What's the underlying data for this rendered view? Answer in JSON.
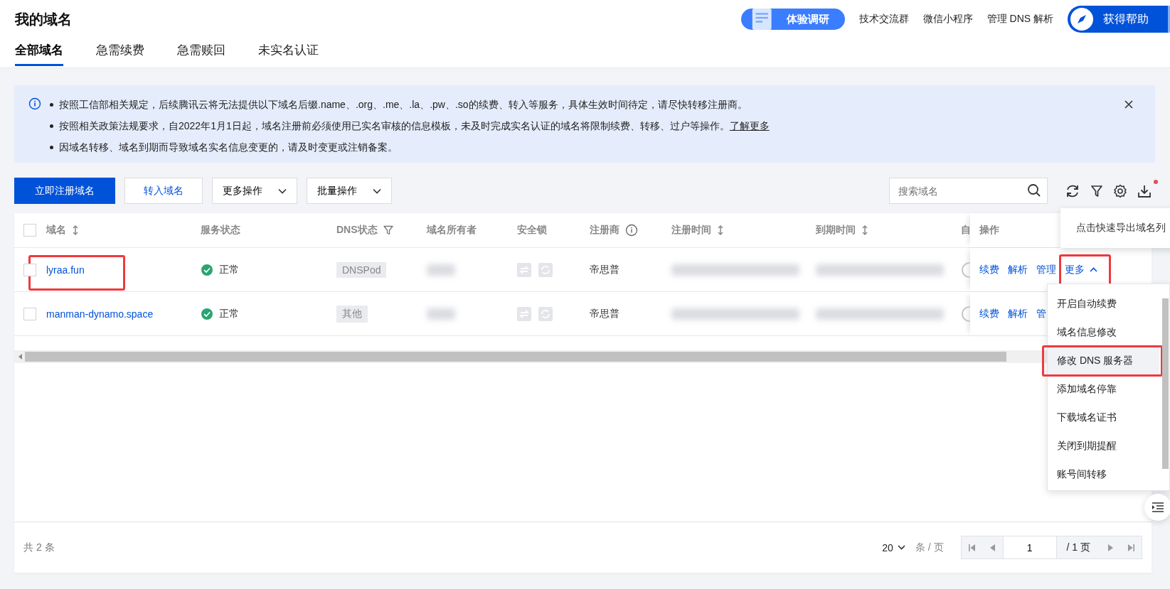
{
  "page_title": "我的域名",
  "tabs": [
    {
      "label": "全部域名",
      "selected": true
    },
    {
      "label": "急需续费",
      "selected": false
    },
    {
      "label": "急需赎回",
      "selected": false
    },
    {
      "label": "未实名认证",
      "selected": false
    }
  ],
  "header_actions": {
    "survey": "体验调研",
    "links": [
      "技术交流群",
      "微信小程序",
      "管理 DNS 解析"
    ],
    "help": "获得帮助"
  },
  "notice": {
    "lines": [
      {
        "text": "按照工信部相关规定，后续腾讯云将无法提供以下域名后缀.name、.org、.me、.la、.pw、.so的续费、转入等服务，具体生效时间待定，请尽快转移注册商。"
      },
      {
        "text": "按照相关政策法规要求，自2022年1月1日起，域名注册前必须使用已实名审核的信息模板，未及时完成实名认证的域名将限制续费、转移、过户等操作。",
        "link": "了解更多"
      },
      {
        "text": "因域名转移、域名到期而导致域名实名信息变更的，请及时变更或注销备案。"
      }
    ]
  },
  "toolbar": {
    "buttons": [
      {
        "label": "立即注册域名",
        "kind": "primary"
      },
      {
        "label": "转入域名",
        "kind": "secondary"
      },
      {
        "label": "更多操作",
        "kind": "dropdown"
      },
      {
        "label": "批量操作",
        "kind": "dropdown"
      }
    ],
    "search": {
      "placeholder": "搜索域名"
    },
    "export_badge": true
  },
  "tooltip": "点击快速导出域名列",
  "table": {
    "all_checked": false,
    "columns": [
      {
        "label": "域名",
        "kind": "sort"
      },
      {
        "label": "服务状态",
        "kind": "plain"
      },
      {
        "label": "DNS状态",
        "kind": "filter"
      },
      {
        "label": "域名所有者",
        "kind": "plain"
      },
      {
        "label": "安全锁",
        "kind": "plain"
      },
      {
        "label": "注册商",
        "kind": "info"
      },
      {
        "label": "注册时间",
        "kind": "sort"
      },
      {
        "label": "到期时间",
        "kind": "sort"
      },
      {
        "label": "自",
        "kind": "plain"
      }
    ],
    "action_column": "操作",
    "rows": [
      {
        "checked": false,
        "domain": "lyraa.fun",
        "highlighted": true,
        "status": "正常",
        "dns": "DNSPod",
        "registrar": "帝思普",
        "auto_renew": false,
        "actions": [
          {
            "label": "续费"
          },
          {
            "label": "解析"
          },
          {
            "label": "管理"
          },
          {
            "label": "更多",
            "kind": "menu",
            "expanded": true,
            "highlighted": true,
            "menu_items": [
              {
                "label": "开启自动续费",
                "selected": false,
                "highlighted": false
              },
              {
                "label": "域名信息修改",
                "selected": false,
                "highlighted": false
              },
              {
                "label": "修改 DNS 服务器",
                "selected": true,
                "highlighted": true
              },
              {
                "label": "添加域名停靠",
                "selected": false,
                "highlighted": false
              },
              {
                "label": "下载域名证书",
                "selected": false,
                "highlighted": false
              },
              {
                "label": "关闭到期提醒",
                "selected": false,
                "highlighted": false
              },
              {
                "label": "账号间转移",
                "selected": false,
                "highlighted": false
              }
            ]
          }
        ]
      },
      {
        "checked": false,
        "domain": "manman-dynamo.space",
        "highlighted": false,
        "status": "正常",
        "dns": "其他",
        "registrar": "帝思普",
        "auto_renew": false,
        "actions": [
          {
            "label": "续费"
          },
          {
            "label": "解析"
          },
          {
            "label": "管"
          }
        ]
      }
    ]
  },
  "pagination": {
    "total": "共 2 条",
    "page_size": "20",
    "page_size_unit": "条 / 页",
    "page": "1",
    "page_count": "/ 1 页"
  }
}
